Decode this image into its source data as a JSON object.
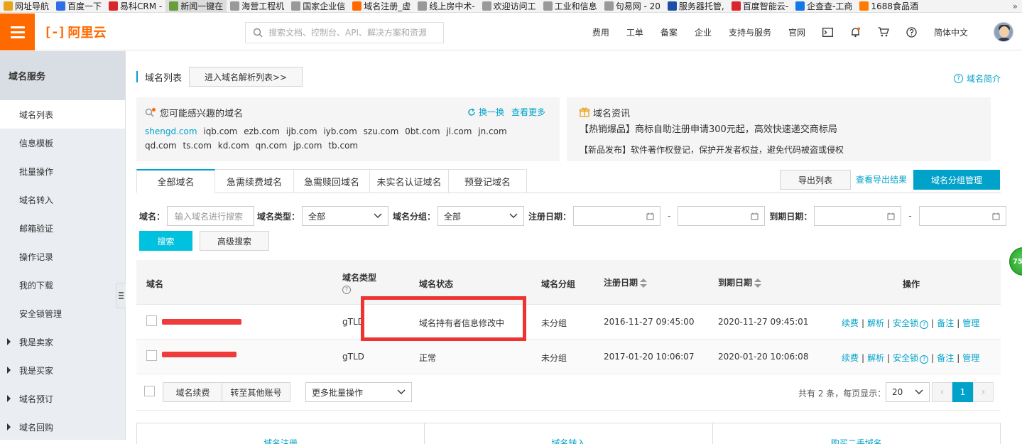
{
  "bookmarks": [
    {
      "label": "网址导航",
      "color": "#e8a317"
    },
    {
      "label": "百度一下",
      "color": "#2f6ee6"
    },
    {
      "label": "易科CRM -",
      "color": "#d9262c"
    },
    {
      "label": "新闻一键在",
      "color": "#6a9e3a"
    },
    {
      "label": "海营工程机",
      "color": "#999999"
    },
    {
      "label": "国家企业信",
      "color": "#999999"
    },
    {
      "label": "域名注册_虚",
      "color": "#ff6a00"
    },
    {
      "label": "线上房中术-",
      "color": "#999999"
    },
    {
      "label": "欢迎访问工",
      "color": "#999999"
    },
    {
      "label": "工业和信息",
      "color": "#999999"
    },
    {
      "label": "句易网 - 20",
      "color": "#999999"
    },
    {
      "label": "服务器托管,",
      "color": "#1d4fa8"
    },
    {
      "label": "百度智能云-",
      "color": "#d9262c"
    },
    {
      "label": "企查查-工商",
      "color": "#1477e6"
    },
    {
      "label": "1688食品酒",
      "color": "#ff7a00"
    }
  ],
  "bookmarks_more": "»",
  "header": {
    "logo_mark": "[-]",
    "logo_text": "阿里云",
    "search_placeholder": "搜索文档、控制台、API、解决方案和资源",
    "nav": [
      "费用",
      "工单",
      "备案",
      "企业",
      "支持与服务",
      "官网"
    ],
    "language": "简体中文"
  },
  "sidebar": {
    "title": "域名服务",
    "items": [
      {
        "label": "域名列表",
        "active": true,
        "expandable": false
      },
      {
        "label": "信息模板",
        "active": false,
        "expandable": false
      },
      {
        "label": "批量操作",
        "active": false,
        "expandable": false
      },
      {
        "label": "域名转入",
        "active": false,
        "expandable": false
      },
      {
        "label": "邮箱验证",
        "active": false,
        "expandable": false
      },
      {
        "label": "操作记录",
        "active": false,
        "expandable": false
      },
      {
        "label": "我的下载",
        "active": false,
        "expandable": false
      },
      {
        "label": "安全锁管理",
        "active": false,
        "expandable": false
      },
      {
        "label": "我是卖家",
        "active": false,
        "expandable": true
      },
      {
        "label": "我是买家",
        "active": false,
        "expandable": true
      },
      {
        "label": "域名预订",
        "active": false,
        "expandable": true
      },
      {
        "label": "域名回购",
        "active": false,
        "expandable": true
      }
    ]
  },
  "page": {
    "title": "域名列表",
    "enter_dns_button": "进入域名解析列表>>",
    "intro_link": "域名简介"
  },
  "suggest": {
    "title": "您可能感兴趣的域名",
    "refresh": "换一换",
    "more": "查看更多",
    "domains": [
      "shengd.com",
      "iqb.com",
      "ezb.com",
      "ijb.com",
      "iyb.com",
      "szu.com",
      "0bt.com",
      "jl.com",
      "jn.com",
      "qd.com",
      "ts.com",
      "kd.com",
      "qn.com",
      "jp.com",
      "tb.com"
    ]
  },
  "news": {
    "title": "域名资讯",
    "line1": "【热销爆品】商标自助注册申请300元起，高效快速递交商标局",
    "line2": "【新品发布】软件著作权登记，保护开发者权益，避免代码被盗或侵权"
  },
  "tabs": [
    "全部域名",
    "急需续费域名",
    "急需赎回域名",
    "未实名认证域名",
    "预登记域名"
  ],
  "toolbar": {
    "export": "导出列表",
    "export_result": "查看导出结果",
    "group_manage": "域名分组管理"
  },
  "filters": {
    "domain_label": "域名：",
    "domain_placeholder": "输入域名进行搜索",
    "type_label": "域名类型：",
    "type_value": "全部",
    "group_label": "域名分组：",
    "group_value": "全部",
    "reg_label": "注册日期：",
    "exp_label": "到期日期：",
    "dash": "-",
    "search": "搜索",
    "advanced": "高级搜索"
  },
  "table": {
    "headers": {
      "domain": "域名",
      "type": "域名类型",
      "status": "域名状态",
      "group": "域名分组",
      "reg_date": "注册日期",
      "exp_date": "到期日期",
      "ops": "操作"
    },
    "rows": [
      {
        "type": "gTLD",
        "status": "域名持有者信息修改中",
        "group": "未分组",
        "reg_date": "2016-11-27 09:45:00",
        "exp_date": "2020-11-27 09:45:01"
      },
      {
        "type": "gTLD",
        "status": "正常",
        "group": "未分组",
        "reg_date": "2017-01-20 10:06:07",
        "exp_date": "2020-01-20 10:06:08"
      }
    ],
    "ops": [
      "续费",
      "解析",
      "安全锁",
      "备注",
      "管理"
    ],
    "ops_sep": "|",
    "ops_info_mark": "?"
  },
  "footer": {
    "renew": "域名续费",
    "transfer": "转至其他账号",
    "batch": "更多批量操作",
    "info": "共有 2 条，每页显示：",
    "page_size": "20",
    "current_page": "1",
    "prev": "‹",
    "next": "›"
  },
  "bottom_cards": [
    "域名注册",
    "域名转入",
    "购买二手域名"
  ],
  "float_badge": "75"
}
